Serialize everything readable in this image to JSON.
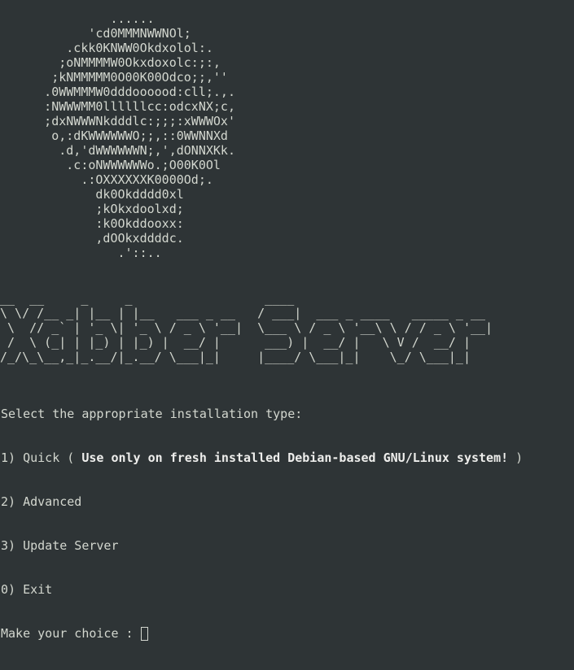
{
  "terminal": {
    "background": "#2e3436",
    "foreground": "#d3d7cf",
    "logo_art": "               ......\n            'cd0MMMNWWNOl;\n         .ckk0KNWW0Okdxolol:.\n        ;oNMMMMW0Okxdoxolc:;:,\n       ;kNMMMMM0O00K00Odco;;,''\n      .0WWMMMW0dddoooood:cll;.,.\n      :NWWWMM0llllllcc:odcxNX;c,\n      ;dxNWWWNkdddlc:;;;:xWWWOx'\n       o,:dKWWWWWWO;;,::0WWNNXd\n        .d,'dWWWWWWN;,',dONNXKk.\n         .c:oNWWWWWWo.;O00K0Ol\n           .:OXXXXXXK0000Od;.\n             dk0Okdddd0xl\n             ;kOkxdoolxd;\n             :k0Okddooxx:\n             ,dOOkxddddc.\n                .'::..",
    "banner_art": "__  __     _     _                  ____\n\\ \\/ /__ _| |__ | |__   ___ _ __   / ___|  ___ _ ____   _____ _ __\n \\  // _` | '_ \\| '_ \\ / _ \\ '__|  \\___ \\ / _ \\ '__\\ \\ / / _ \\ '__|\n /  \\ (_| | |_) | |_) |  __/ |      ___) |  __/ |   \\ V /  __/ |\n/_/\\_\\__,_|_.__/|_.__/ \\___|_|     |____/ \\___|_|    \\_/ \\___|_|",
    "menu": {
      "prompt": "Select the appropriate installation type:",
      "option1_prefix": "1) Quick ( ",
      "option1_bold": "Use only on fresh installed Debian-based GNU/Linux system!",
      "option1_suffix": " )",
      "option2": "2) Advanced",
      "option3": "3) Update Server",
      "option0": "0) Exit",
      "choice_prompt": "Make your choice : "
    }
  }
}
